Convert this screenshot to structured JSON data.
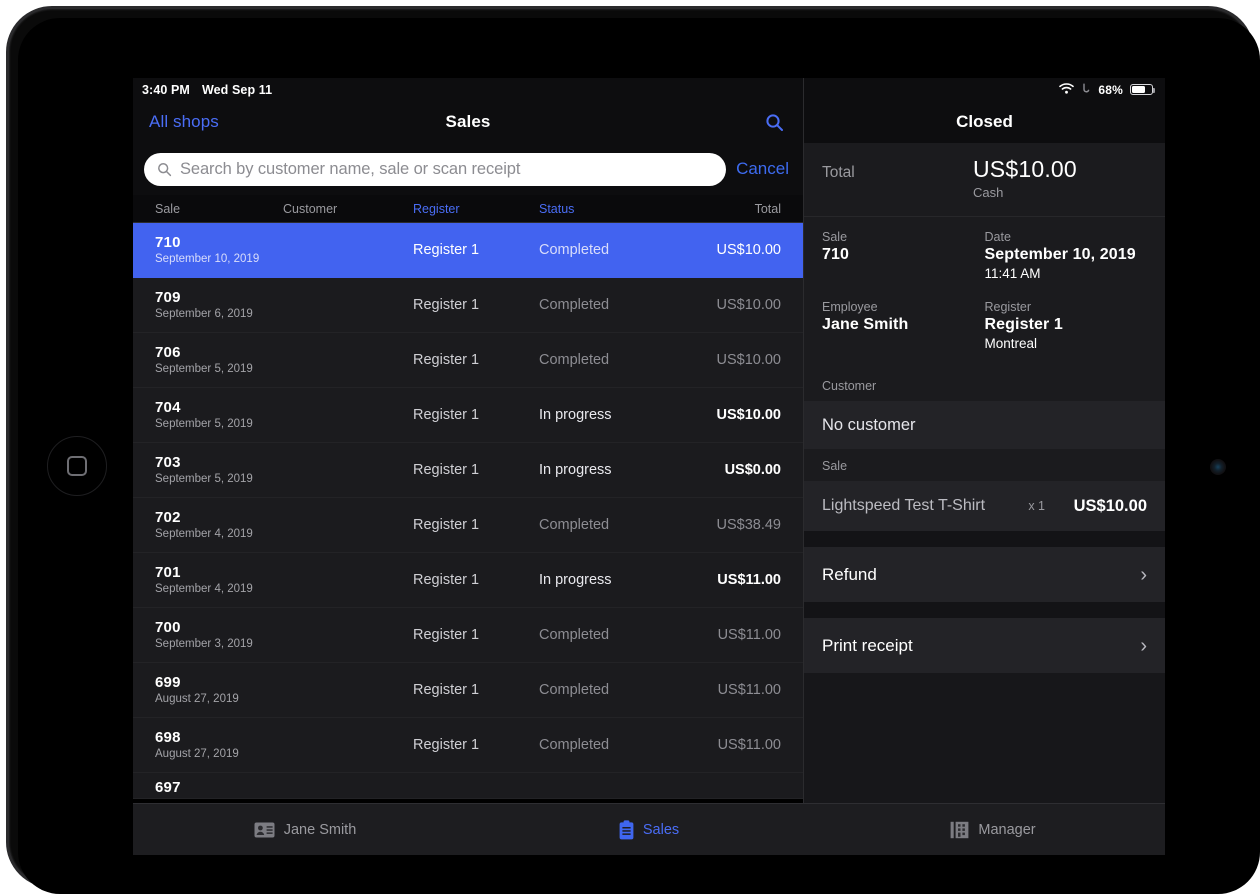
{
  "status_bar": {
    "time": "3:40 PM",
    "date": "Wed Sep 11",
    "battery_percent": "68%",
    "wifi_icon": "wifi-icon",
    "location_icon": "location-arrow-icon",
    "battery_icon": "battery-icon"
  },
  "nav": {
    "back_label": "All shops",
    "title": "Sales",
    "search_icon": "search-icon"
  },
  "search": {
    "placeholder": "Search by customer name, sale or scan receipt",
    "value": "",
    "cancel_label": "Cancel",
    "magnifier_icon": "search-icon"
  },
  "table": {
    "columns": [
      "Sale",
      "Customer",
      "Register",
      "Status",
      "Total"
    ],
    "sort_columns_highlighted": [
      "Register",
      "Status"
    ],
    "rows": [
      {
        "sale": "710",
        "date": "September 10, 2019",
        "customer": "",
        "register": "Register 1",
        "status": "Completed",
        "total": "US$10.00",
        "selected": true,
        "emphasis": false
      },
      {
        "sale": "709",
        "date": "September 6, 2019",
        "customer": "",
        "register": "Register 1",
        "status": "Completed",
        "total": "US$10.00",
        "selected": false,
        "emphasis": false
      },
      {
        "sale": "706",
        "date": "September 5, 2019",
        "customer": "",
        "register": "Register 1",
        "status": "Completed",
        "total": "US$10.00",
        "selected": false,
        "emphasis": false
      },
      {
        "sale": "704",
        "date": "September 5, 2019",
        "customer": "",
        "register": "Register 1",
        "status": "In progress",
        "total": "US$10.00",
        "selected": false,
        "emphasis": true
      },
      {
        "sale": "703",
        "date": "September 5, 2019",
        "customer": "",
        "register": "Register 1",
        "status": "In progress",
        "total": "US$0.00",
        "selected": false,
        "emphasis": true
      },
      {
        "sale": "702",
        "date": "September 4, 2019",
        "customer": "",
        "register": "Register 1",
        "status": "Completed",
        "total": "US$38.49",
        "selected": false,
        "emphasis": false
      },
      {
        "sale": "701",
        "date": "September 4, 2019",
        "customer": "",
        "register": "Register 1",
        "status": "In progress",
        "total": "US$11.00",
        "selected": false,
        "emphasis": true
      },
      {
        "sale": "700",
        "date": "September 3, 2019",
        "customer": "",
        "register": "Register 1",
        "status": "Completed",
        "total": "US$11.00",
        "selected": false,
        "emphasis": false
      },
      {
        "sale": "699",
        "date": "August 27, 2019",
        "customer": "",
        "register": "Register 1",
        "status": "Completed",
        "total": "US$11.00",
        "selected": false,
        "emphasis": false
      },
      {
        "sale": "698",
        "date": "August 27, 2019",
        "customer": "",
        "register": "Register 1",
        "status": "Completed",
        "total": "US$11.00",
        "selected": false,
        "emphasis": false
      }
    ],
    "partial_row": {
      "sale": "697"
    }
  },
  "detail": {
    "header_title": "Closed",
    "total_label": "Total",
    "total_amount": "US$10.00",
    "payment_method": "Cash",
    "fields": {
      "sale_label": "Sale",
      "sale_value": "710",
      "date_label": "Date",
      "date_value": "September 10, 2019",
      "time_value": "11:41 AM",
      "employee_label": "Employee",
      "employee_value": "Jane Smith",
      "register_label": "Register",
      "register_value": "Register 1",
      "register_location": "Montreal"
    },
    "customer_section_label": "Customer",
    "customer_value": "No customer",
    "sale_section_label": "Sale",
    "line_item": {
      "name": "Lightspeed Test T-Shirt",
      "quantity": "x 1",
      "price": "US$10.00"
    },
    "actions": [
      {
        "label": "Refund",
        "chevron": "chevron-right-icon"
      },
      {
        "label": "Print receipt",
        "chevron": "chevron-right-icon"
      }
    ]
  },
  "tab_bar": {
    "items": [
      {
        "label": "Jane Smith",
        "icon": "contact-card-icon",
        "active": false
      },
      {
        "label": "Sales",
        "icon": "clipboard-icon",
        "active": true
      },
      {
        "label": "Manager",
        "icon": "manager-building-icon",
        "active": false
      }
    ]
  },
  "colors": {
    "accent_blue": "#4a6df5",
    "selection_blue": "#4263f0",
    "app_background": "#000000",
    "row_background": "#1b1b1e",
    "detail_background": "#131316",
    "cell_background": "#232327",
    "secondary_text": "#9a9a9f"
  }
}
